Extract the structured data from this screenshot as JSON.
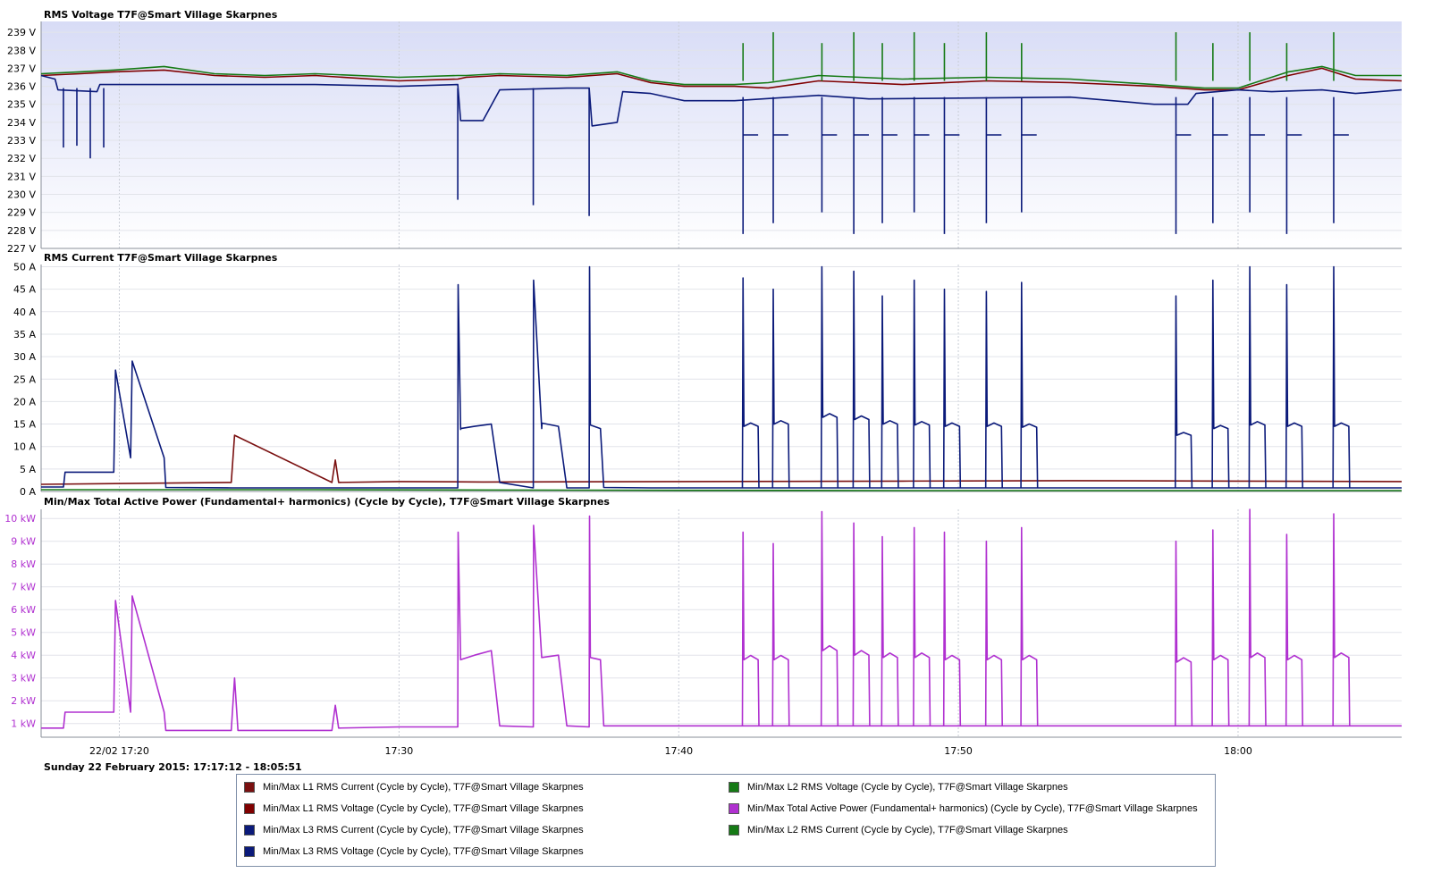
{
  "colors": {
    "l1_current": "#7a1010",
    "l1_voltage": "#800000",
    "l3_current": "#0b1a7a",
    "l3_voltage": "#0b1a7a",
    "l2_voltage": "#157a15",
    "power": "#b030d0",
    "l2_current": "#157a15"
  },
  "date_range": "Sunday 22 February 2015: 17:17:12 - 18:05:51",
  "legend": [
    {
      "label": "Min/Max L1 RMS Current (Cycle by Cycle), T7F@Smart Village Skarpnes",
      "color": "#7a1010"
    },
    {
      "label": "Min/Max L1 RMS Voltage (Cycle by Cycle), T7F@Smart Village Skarpnes",
      "color": "#800000"
    },
    {
      "label": "Min/Max L3 RMS Current (Cycle by Cycle), T7F@Smart Village Skarpnes",
      "color": "#0b1a7a"
    },
    {
      "label": "Min/Max L3 RMS Voltage (Cycle by Cycle), T7F@Smart Village Skarpnes",
      "color": "#0b1a7a"
    },
    {
      "label": "Min/Max L2 RMS Voltage (Cycle by Cycle), T7F@Smart Village Skarpnes",
      "color": "#157a15"
    },
    {
      "label": "Min/Max Total Active Power  (Fundamental+ harmonics) (Cycle by Cycle), T7F@Smart Village Skarpnes",
      "color": "#b030d0"
    },
    {
      "label": "Min/Max L2 RMS Current (Cycle by Cycle), T7F@Smart Village Skarpnes",
      "color": "#157a15"
    }
  ],
  "chart_data": [
    {
      "type": "line",
      "title": "RMS Voltage T7F@Smart Village Skarpnes",
      "unit": "V",
      "xlim": [
        17.2867,
        18.0975
      ],
      "ylim": [
        227,
        239.6
      ],
      "ytick_values": [
        227,
        228,
        229,
        230,
        231,
        232,
        233,
        234,
        235,
        236,
        237,
        238,
        239
      ],
      "ytick_labels": [
        "227 V",
        "228 V",
        "229 V",
        "230 V",
        "231 V",
        "232 V",
        "233 V",
        "234 V",
        "235 V",
        "236 V",
        "237 V",
        "238 V",
        "239 V"
      ],
      "tick_color": "#000000",
      "background": "gradient",
      "series": [
        {
          "name": "Min/Max L1 RMS Voltage (Cycle by Cycle), T7F@Smart Village Skarpnes",
          "color": "#800000",
          "x": [
            17.2867,
            17.31,
            17.33,
            17.36,
            17.39,
            17.42,
            17.45,
            17.5,
            17.535,
            17.54,
            17.56,
            17.6,
            17.63,
            17.65,
            17.67,
            17.7,
            17.72,
            17.75,
            17.8,
            17.85,
            17.9,
            17.95,
            17.98,
            18.0,
            18.03,
            18.05,
            18.07,
            18.0975
          ],
          "values": [
            236.6,
            236.7,
            236.8,
            236.9,
            236.6,
            236.5,
            236.6,
            236.3,
            236.4,
            236.5,
            236.6,
            236.5,
            236.7,
            236.2,
            236.0,
            236.0,
            235.9,
            236.3,
            236.1,
            236.3,
            236.2,
            236.0,
            235.8,
            235.8,
            236.6,
            237.0,
            236.4,
            236.3
          ]
        },
        {
          "name": "Min/Max L2 RMS Voltage (Cycle by Cycle), T7F@Smart Village Skarpnes",
          "color": "#157a15",
          "x": [
            17.2867,
            17.31,
            17.33,
            17.36,
            17.39,
            17.42,
            17.45,
            17.5,
            17.535,
            17.54,
            17.56,
            17.6,
            17.63,
            17.65,
            17.67,
            17.7,
            17.72,
            17.75,
            17.8,
            17.85,
            17.9,
            17.95,
            17.98,
            18.0,
            18.03,
            18.05,
            18.07,
            18.0975
          ],
          "values": [
            236.7,
            236.8,
            236.9,
            237.1,
            236.7,
            236.6,
            236.7,
            236.5,
            236.6,
            236.6,
            236.7,
            236.6,
            236.8,
            236.3,
            236.1,
            236.1,
            236.2,
            236.6,
            236.4,
            236.5,
            236.4,
            236.1,
            235.9,
            235.9,
            236.8,
            237.1,
            236.6,
            236.6
          ]
        },
        {
          "name": "Min/Max L3 RMS Voltage (Cycle by Cycle), T7F@Smart Village Skarpnes",
          "color": "#0b1a7a",
          "x": [
            17.2867,
            17.295,
            17.2967,
            17.32,
            17.3217,
            17.4,
            17.45,
            17.5,
            17.535,
            17.5367,
            17.55,
            17.56,
            17.6,
            17.6133,
            17.615,
            17.63,
            17.6333,
            17.65,
            17.67,
            17.7,
            17.75,
            17.78,
            17.9,
            17.95,
            17.97,
            17.975,
            18.0,
            18.02,
            18.05,
            18.07,
            18.0975
          ],
          "values": [
            236.6,
            236.4,
            235.8,
            235.7,
            236.1,
            236.1,
            236.1,
            236.0,
            236.1,
            234.1,
            234.1,
            235.8,
            235.9,
            235.9,
            233.8,
            234.0,
            235.7,
            235.6,
            235.2,
            235.2,
            235.5,
            235.3,
            235.4,
            235.0,
            235.0,
            235.6,
            235.8,
            235.7,
            235.8,
            235.6,
            235.8
          ]
        }
      ],
      "annotations": [
        {
          "x": 17.3,
          "values": [
            232.6,
            232.7,
            232.0,
            232.6
          ]
        },
        {
          "x": 17.535,
          "value": 229.7
        },
        {
          "x": 17.58,
          "value": 229.4
        },
        {
          "x": 17.6133,
          "value": 228.8
        }
      ]
    },
    {
      "type": "line",
      "title": "RMS Current T7F@Smart Village Skarpnes",
      "unit": "A",
      "xlim": [
        17.2867,
        18.0975
      ],
      "ylim": [
        0,
        50.5
      ],
      "ytick_values": [
        0,
        5,
        10,
        15,
        20,
        25,
        30,
        35,
        40,
        45,
        50
      ],
      "ytick_labels": [
        "0 A",
        "5 A",
        "10 A",
        "15 A",
        "20 A",
        "25 A",
        "30 A",
        "35 A",
        "40 A",
        "45 A",
        "50 A"
      ],
      "tick_color": "#000000",
      "background": "#ffffff",
      "series": [
        {
          "name": "Min/Max L1 RMS Current (Cycle by Cycle), T7F@Smart Village Skarpnes",
          "color": "#7a1010",
          "x": [
            17.2867,
            17.4,
            17.4,
            17.402,
            17.46,
            17.462,
            17.464,
            17.5,
            17.55,
            17.8,
            17.9,
            18.0,
            18.0975
          ],
          "values": [
            1.6,
            2.0,
            2.0,
            12.5,
            2.0,
            7.0,
            2.0,
            2.2,
            2.1,
            2.3,
            2.4,
            2.3,
            2.2
          ]
        },
        {
          "name": "Min/Max L2 RMS Current (Cycle by Cycle), T7F@Smart Village Skarpnes",
          "color": "#157a15",
          "x": [
            17.2867,
            17.45,
            17.6,
            17.8,
            18.0,
            18.0975
          ],
          "values": [
            0.4,
            0.4,
            0.3,
            0.2,
            0.2,
            0.2
          ]
        },
        {
          "name": "Min/Max L3 RMS Current (Cycle by Cycle), T7F@Smart Village Skarpnes",
          "color": "#0b1a7a",
          "x": [
            17.2867,
            17.3,
            17.301,
            17.33,
            17.331,
            17.34,
            17.341,
            17.36,
            17.361,
            17.4,
            17.535,
            17.5352,
            17.5367,
            17.5368,
            17.545,
            17.555,
            17.56,
            17.58,
            17.5802,
            17.585,
            17.5852,
            17.595,
            17.6,
            17.6133,
            17.6135,
            17.614,
            17.62,
            17.622,
            17.65,
            17.7,
            17.7,
            17.7,
            17.75,
            17.8,
            17.85,
            17.9,
            17.95,
            17.98,
            18.0,
            18.05,
            18.0975
          ],
          "values": [
            1.0,
            1.0,
            4.3,
            4.3,
            27.0,
            7.5,
            29.0,
            7.5,
            0.9,
            0.8,
            0.8,
            46.0,
            13.8,
            14.0,
            14.5,
            15.0,
            2.0,
            0.8,
            47.0,
            14.0,
            15.2,
            14.5,
            0.8,
            0.8,
            50.0,
            14.8,
            14.0,
            0.9,
            0.8,
            0.8,
            0.8,
            0.8,
            0.8,
            0.8,
            0.8,
            0.8,
            0.8,
            0.8,
            0.8,
            0.8,
            0.8
          ]
        }
      ],
      "events": [
        {
          "x": 17.705,
          "peak": 47.5,
          "plateau": 14.5
        },
        {
          "x": 17.723,
          "peak": 45.0,
          "plateau": 15.0
        },
        {
          "x": 17.752,
          "peak": 50.0,
          "plateau": 16.5
        },
        {
          "x": 17.771,
          "peak": 49.0,
          "plateau": 16.0
        },
        {
          "x": 17.788,
          "peak": 43.5,
          "plateau": 15.0
        },
        {
          "x": 17.807,
          "peak": 47.0,
          "plateau": 14.8
        },
        {
          "x": 17.825,
          "peak": 45.0,
          "plateau": 14.5
        },
        {
          "x": 17.85,
          "peak": 44.5,
          "plateau": 14.5
        },
        {
          "x": 17.871,
          "peak": 46.5,
          "plateau": 14.3
        },
        {
          "x": 17.963,
          "peak": 43.5,
          "plateau": 12.5
        },
        {
          "x": 17.985,
          "peak": 47.0,
          "plateau": 14.0
        },
        {
          "x": 18.007,
          "peak": 50.0,
          "plateau": 14.8
        },
        {
          "x": 18.029,
          "peak": 46.0,
          "plateau": 14.5
        },
        {
          "x": 18.057,
          "peak": 50.0,
          "plateau": 14.5
        }
      ]
    },
    {
      "type": "line",
      "title": "Min/Max Total Active Power (Fundamental+ harmonics) (Cycle by Cycle), T7F@Smart Village Skarpnes",
      "unit": "kW",
      "xlim": [
        17.2867,
        18.0975
      ],
      "ylim": [
        0.4,
        10.4
      ],
      "ytick_values": [
        1,
        2,
        3,
        4,
        5,
        6,
        7,
        8,
        9,
        10
      ],
      "ytick_labels": [
        "1 kW",
        "2 kW",
        "3 kW",
        "4 kW",
        "5 kW",
        "6 kW",
        "7 kW",
        "8 kW",
        "9 kW",
        "10 kW"
      ],
      "tick_color": "#b030d0",
      "background": "#ffffff",
      "x_tick_values": [
        17.3333,
        17.5,
        17.6667,
        17.8333,
        18.0
      ],
      "x_tick_labels": [
        "22/02 17:20",
        "17:30",
        "17:40",
        "17:50",
        "18:00"
      ],
      "series": [
        {
          "name": "Min/Max Total Active Power  (Fundamental+ harmonics) (Cycle by Cycle), T7F@Smart Village Skarpnes",
          "color": "#b030d0",
          "x": [
            17.2867,
            17.3,
            17.301,
            17.33,
            17.331,
            17.34,
            17.341,
            17.36,
            17.361,
            17.4,
            17.402,
            17.404,
            17.46,
            17.462,
            17.464,
            17.5,
            17.535,
            17.5352,
            17.5367,
            17.545,
            17.555,
            17.56,
            17.58,
            17.5802,
            17.585,
            17.595,
            17.6,
            17.6133,
            17.6135,
            17.614,
            17.62,
            17.622,
            17.65,
            17.7,
            17.75,
            17.8,
            17.85,
            17.9,
            17.95,
            18.0,
            18.05,
            18.0975
          ],
          "values": [
            0.8,
            0.8,
            1.5,
            1.5,
            6.4,
            1.5,
            6.6,
            1.5,
            0.7,
            0.7,
            3.0,
            0.7,
            0.7,
            1.8,
            0.8,
            0.85,
            0.85,
            9.4,
            3.8,
            4.0,
            4.2,
            0.9,
            0.85,
            9.7,
            3.9,
            4.0,
            0.9,
            0.85,
            10.1,
            3.9,
            3.8,
            0.9,
            0.9,
            0.9,
            0.9,
            0.9,
            0.9,
            0.9,
            0.9,
            0.9,
            0.9,
            0.9
          ]
        }
      ],
      "events": [
        {
          "x": 17.705,
          "peak": 9.4,
          "plateau": 3.8
        },
        {
          "x": 17.723,
          "peak": 8.9,
          "plateau": 3.8
        },
        {
          "x": 17.752,
          "peak": 10.3,
          "plateau": 4.2
        },
        {
          "x": 17.771,
          "peak": 9.8,
          "plateau": 4.0
        },
        {
          "x": 17.788,
          "peak": 9.2,
          "plateau": 3.9
        },
        {
          "x": 17.807,
          "peak": 9.6,
          "plateau": 3.9
        },
        {
          "x": 17.825,
          "peak": 9.4,
          "plateau": 3.8
        },
        {
          "x": 17.85,
          "peak": 9.0,
          "plateau": 3.8
        },
        {
          "x": 17.871,
          "peak": 9.6,
          "plateau": 3.8
        },
        {
          "x": 17.963,
          "peak": 9.0,
          "plateau": 3.7
        },
        {
          "x": 17.985,
          "peak": 9.5,
          "plateau": 3.8
        },
        {
          "x": 18.007,
          "peak": 10.4,
          "plateau": 3.9
        },
        {
          "x": 18.029,
          "peak": 9.3,
          "plateau": 3.8
        },
        {
          "x": 18.057,
          "peak": 10.2,
          "plateau": 3.9
        }
      ]
    }
  ]
}
